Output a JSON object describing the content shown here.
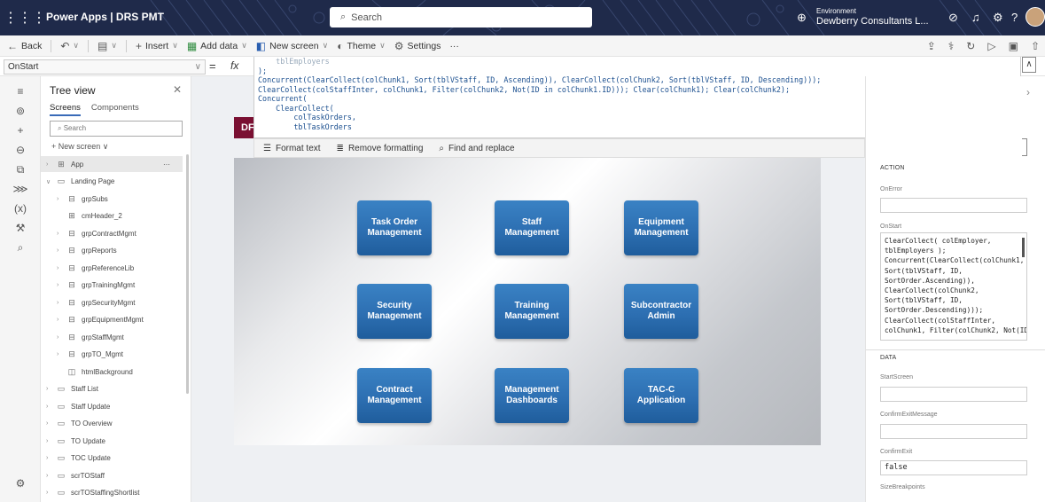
{
  "topbar": {
    "app_title": "Power Apps | DRS PMT",
    "search_placeholder": "Search",
    "environment_label": "Environment",
    "environment_name": "Dewberry Consultants L..."
  },
  "commandbar": {
    "back": "Back",
    "insert": "Insert",
    "add_data": "Add data",
    "new_screen": "New screen",
    "theme": "Theme",
    "settings": "Settings",
    "more": "···"
  },
  "formulabar": {
    "property": "OnStart",
    "equals": "=",
    "fx": "fx"
  },
  "code": {
    "lines": [
      "    tblEmployers",
      ");",
      "Concurrent(ClearCollect(colChunk1, Sort(tblVStaff, ID, Ascending)), ClearCollect(colChunk2, Sort(tblVStaff, ID, Descending)));",
      "ClearCollect(colStaffInter, colChunk1, Filter(colChunk2, Not(ID in colChunk1.ID))); Clear(colChunk1); Clear(colChunk2);",
      "Concurrent(",
      "    ClearCollect(",
      "        colTaskOrders,",
      "        tblTaskOrders"
    ],
    "format_text": "Format text",
    "remove_formatting": "Remove formatting",
    "find_replace": "Find and replace"
  },
  "treeview": {
    "title": "Tree view",
    "tab_screens": "Screens",
    "tab_components": "Components",
    "search_placeholder": "Search",
    "new_screen": "New screen",
    "items": [
      {
        "label": "App",
        "level": 0,
        "icon": "app"
      },
      {
        "label": "Landing Page",
        "level": 0,
        "icon": "screen"
      },
      {
        "label": "grpSubs",
        "level": 1,
        "icon": "group"
      },
      {
        "label": "cmHeader_2",
        "level": 1,
        "icon": "component"
      },
      {
        "label": "grpContractMgmt",
        "level": 1,
        "icon": "group"
      },
      {
        "label": "grpReports",
        "level": 1,
        "icon": "group"
      },
      {
        "label": "grpReferenceLib",
        "level": 1,
        "icon": "group"
      },
      {
        "label": "grpTrainingMgmt",
        "level": 1,
        "icon": "group"
      },
      {
        "label": "grpSecurityMgmt",
        "level": 1,
        "icon": "group"
      },
      {
        "label": "grpEquipmentMgmt",
        "level": 1,
        "icon": "group"
      },
      {
        "label": "grpStaffMgmt",
        "level": 1,
        "icon": "group"
      },
      {
        "label": "grpTO_Mgmt",
        "level": 1,
        "icon": "group"
      },
      {
        "label": "htmlBackground",
        "level": 1,
        "icon": "html"
      },
      {
        "label": "Staff List",
        "level": 0,
        "icon": "screen"
      },
      {
        "label": "Staff Update",
        "level": 0,
        "icon": "screen"
      },
      {
        "label": "TO Overview",
        "level": 0,
        "icon": "screen"
      },
      {
        "label": "TO Update",
        "level": 0,
        "icon": "screen"
      },
      {
        "label": "TOC Update",
        "level": 0,
        "icon": "screen"
      },
      {
        "label": "scrTOStaff",
        "level": 0,
        "icon": "screen"
      },
      {
        "label": "scrTOStaffingShortlist",
        "level": 0,
        "icon": "screen"
      }
    ]
  },
  "canvas": {
    "header_text": "DF",
    "tiles": [
      {
        "label": "Task Order Management"
      },
      {
        "label": "Staff Management"
      },
      {
        "label": "Equipment Management"
      },
      {
        "label": "Security Management"
      },
      {
        "label": "Training Management"
      },
      {
        "label": "Subcontractor Admin"
      },
      {
        "label": "Contract Management"
      },
      {
        "label": "Management Dashboards"
      },
      {
        "label": "TAC-C Application"
      }
    ]
  },
  "properties": {
    "section_action": "ACTION",
    "on_error_label": "OnError",
    "on_error_value": "",
    "on_start_label": "OnStart",
    "on_start_lines": [
      "ClearCollect( colEmployer,",
      "tblEmployers );",
      "Concurrent(ClearCollect(colChunk1,",
      "Sort(tblVStaff, ID,",
      "SortOrder.Ascending)),",
      "ClearCollect(colChunk2,",
      "Sort(tblVStaff, ID,",
      "SortOrder.Descending)));",
      "ClearCollect(colStaffInter,",
      "colChunk1, Filter(colChunk2, Not(ID"
    ],
    "section_data": "DATA",
    "start_screen_label": "StartScreen",
    "start_screen_value": "",
    "confirm_exit_message_label": "ConfirmExitMessage",
    "confirm_exit_message_value": "",
    "confirm_exit_label": "ConfirmExit",
    "confirm_exit_value": "false",
    "size_breakpoints_label": "SizeBreakpoints"
  },
  "colors": {
    "topbar": "#1f2a4a",
    "tile": "#2d6fb2",
    "header_strip": "#7a1032"
  }
}
